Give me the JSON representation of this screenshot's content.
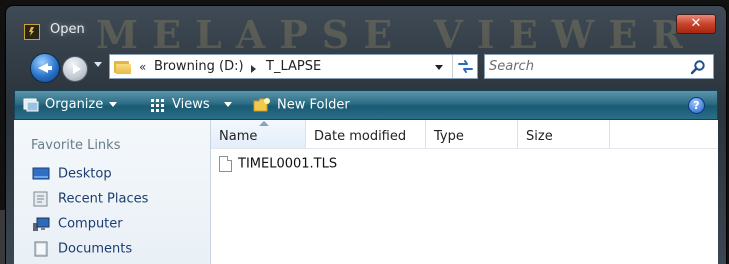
{
  "window": {
    "title": "Open",
    "background_banner": "MELAPSE VIEWER PLUS",
    "close_glyph": "✕"
  },
  "address_bar": {
    "overflow_glyph": "«",
    "path": [
      "Browning (D:)",
      "T_LAPSE"
    ]
  },
  "search": {
    "placeholder": "Search"
  },
  "toolbar": {
    "organize_label": "Organize",
    "views_label": "Views",
    "new_folder_label": "New Folder",
    "help_glyph": "?"
  },
  "nav_pane": {
    "title": "Favorite Links",
    "items": [
      {
        "label": "Desktop",
        "icon": "desktop-icon"
      },
      {
        "label": "Recent Places",
        "icon": "recent-places-icon"
      },
      {
        "label": "Computer",
        "icon": "computer-icon"
      },
      {
        "label": "Documents",
        "icon": "documents-icon"
      }
    ]
  },
  "file_list": {
    "columns": [
      "Name",
      "Date modified",
      "Type",
      "Size"
    ],
    "sorted_column": "Name",
    "files": [
      {
        "name": "TIMEL0001.TLS"
      }
    ]
  },
  "colors": {
    "toolbar_accent": "#2b6d85",
    "link_text": "#1c3d6e",
    "close_button": "#c8432b"
  }
}
